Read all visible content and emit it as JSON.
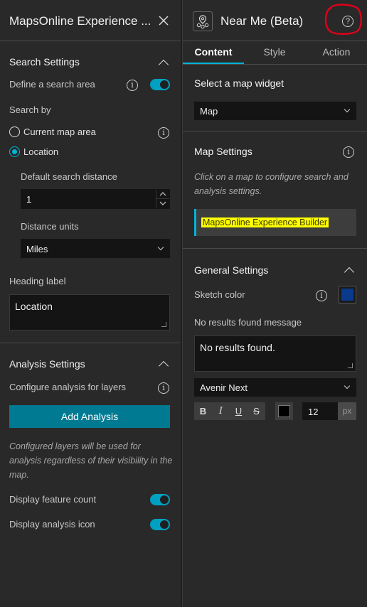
{
  "left": {
    "title": "MapsOnline Experience ...",
    "search_settings": {
      "heading": "Search Settings",
      "define_area_label": "Define a search area",
      "search_by_label": "Search by",
      "option_current": "Current map area",
      "option_location": "Location",
      "selected": "Location",
      "default_distance_label": "Default search distance",
      "default_distance_value": "1",
      "distance_units_label": "Distance units",
      "distance_units_value": "Miles",
      "heading_label": "Heading label",
      "heading_value": "Location"
    },
    "analysis_settings": {
      "heading": "Analysis Settings",
      "configure_label": "Configure analysis for layers",
      "add_button": "Add Analysis",
      "note": "Configured layers will be used for analysis regardless of their visibility in the map.",
      "display_count_label": "Display feature count",
      "display_icon_label": "Display analysis icon"
    }
  },
  "right": {
    "title": "Near Me (Beta)",
    "tabs": [
      "Content",
      "Style",
      "Action"
    ],
    "active_tab": "Content",
    "select_widget_label": "Select a map widget",
    "map_select_value": "Map",
    "map_settings": {
      "heading": "Map Settings",
      "hint": "Click on a map to configure search and analysis settings.",
      "map_item": "MapsOnline Experience Builder"
    },
    "general_settings": {
      "heading": "General Settings",
      "sketch_color_label": "Sketch color",
      "sketch_color": "#0a3a8c",
      "no_results_label": "No results found message",
      "no_results_value": "No results found.",
      "font_value": "Avenir Next",
      "font_size": "12",
      "font_unit": "px",
      "format_buttons": [
        "B",
        "I",
        "U",
        "S"
      ],
      "text_color": "#000000"
    }
  },
  "colors": {
    "accent": "#00a0c0",
    "button": "#007a93",
    "highlight": "#ffff00",
    "annotation": "#e0001b"
  }
}
